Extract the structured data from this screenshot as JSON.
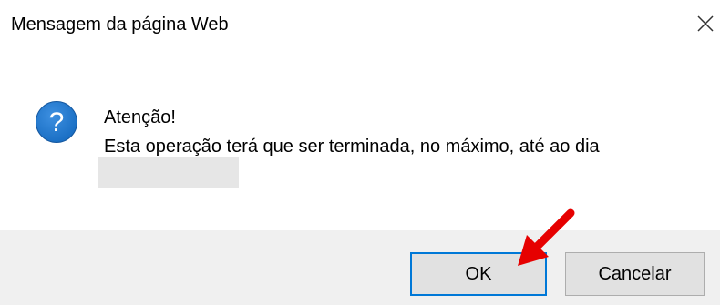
{
  "dialog": {
    "title": "Mensagem da página Web",
    "close_icon": "close-icon",
    "icon": "question-icon",
    "icon_color": "#1a6fc4",
    "message_line1": "Atenção!",
    "message_line2": "Esta operação terá que ser terminada, no máximo, até ao dia",
    "ok_label": "OK",
    "cancel_label": "Cancelar"
  },
  "annotation": {
    "arrow_icon": "red-arrow-icon",
    "arrow_color": "#e60000"
  },
  "colors": {
    "footer_background": "#f0f0f0",
    "button_background": "#e1e1e1",
    "focus_border": "#0078d7"
  }
}
